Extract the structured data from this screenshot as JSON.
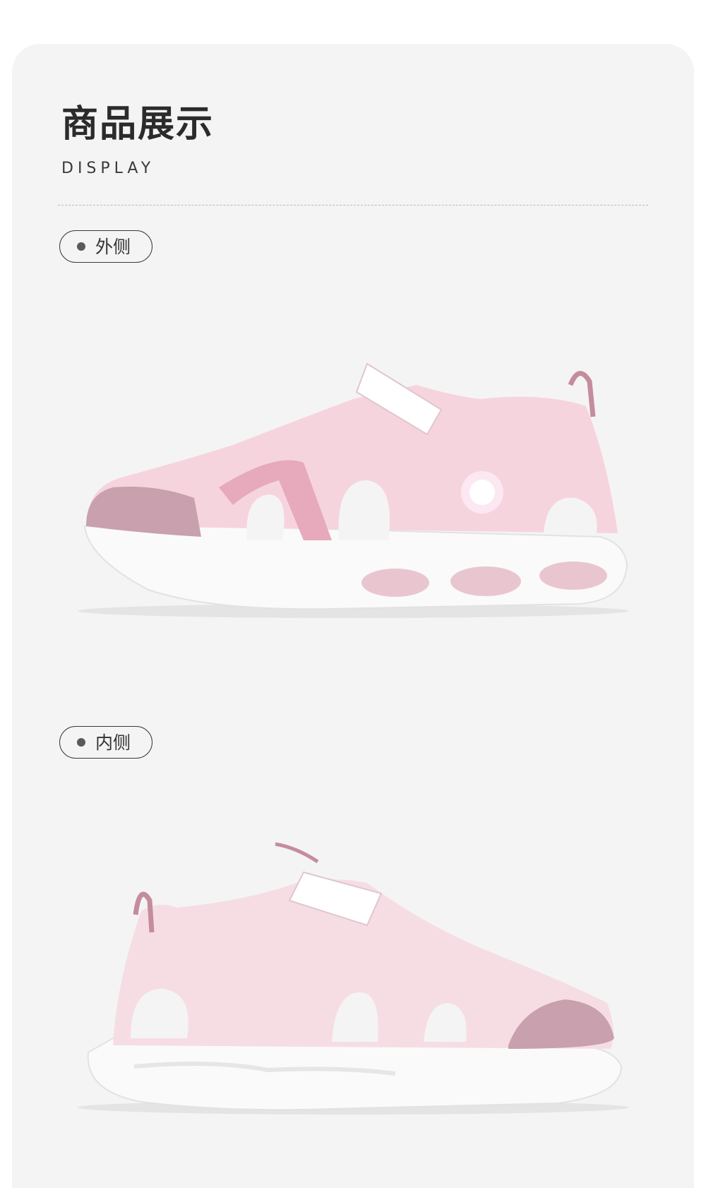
{
  "header": {
    "title": "商品展示",
    "subtitle": "DISPLAY"
  },
  "views": [
    {
      "label": "外侧",
      "image_desc": "pink-sandal-outer-side"
    },
    {
      "label": "内侧",
      "image_desc": "pink-sandal-inner-side"
    }
  ],
  "colors": {
    "card_bg": "#f4f4f4",
    "text_dark": "#2b2b2b",
    "shoe_pink": "#f6d4de",
    "shoe_mauve": "#c9a0ad",
    "sole_white": "#fafafa"
  }
}
